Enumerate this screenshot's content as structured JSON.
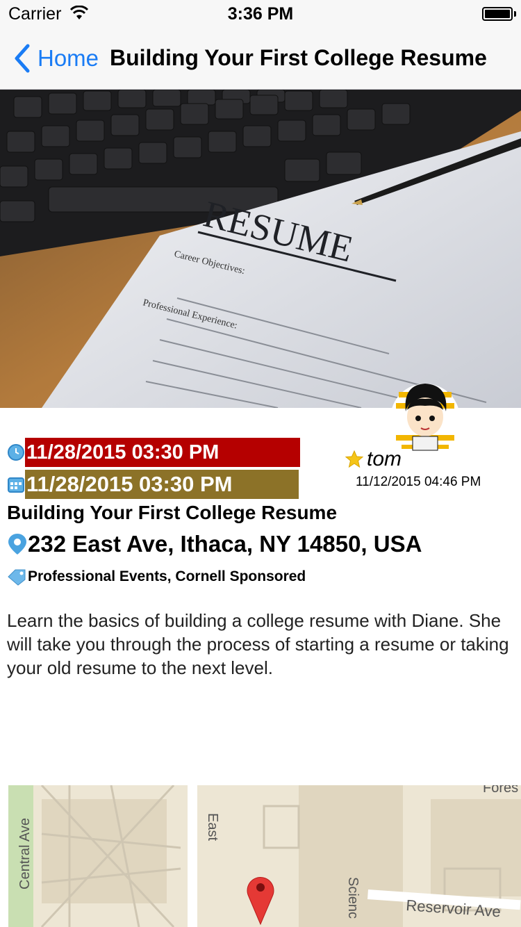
{
  "status_bar": {
    "carrier": "Carrier",
    "time": "3:36 PM",
    "wifi_icon": "wifi-icon",
    "battery_icon": "battery-icon"
  },
  "nav": {
    "back_label": "Home",
    "title": "Building Your First College Resume",
    "accent_color": "#1a7cf5"
  },
  "hero": {
    "image": "resume-on-desk-with-keyboard-and-pen",
    "resume_heading": "RESUME",
    "section_career": "Career Objectives:",
    "section_experience": "Professional Experience:"
  },
  "event": {
    "start_datetime": "11/28/2015 03:30 PM",
    "end_datetime": "11/28/2015 03:30 PM",
    "start_color": "#b50000",
    "end_color": "#8c7228",
    "title": "Building Your First College Resume",
    "address": "232 East Ave, Ithaca, NY 14850, USA",
    "tags": "Professional Events, Cornell Sponsored",
    "description": "Learn the basics of building a college resume with Diane. She will take you through the process of starting a resume or taking your old resume to the next level."
  },
  "author": {
    "name": "tom",
    "posted_at": "11/12/2015 04:46 PM",
    "avatar_icon": "avatar-icon",
    "star_icon": "star-icon"
  },
  "map": {
    "labels": {
      "central_ave": "Central Ave",
      "east_ave": "East",
      "science": "Scienc",
      "reservoir_ave": "Reservoir Ave",
      "forest": "Fores"
    },
    "pin_icon": "map-pin-icon"
  }
}
